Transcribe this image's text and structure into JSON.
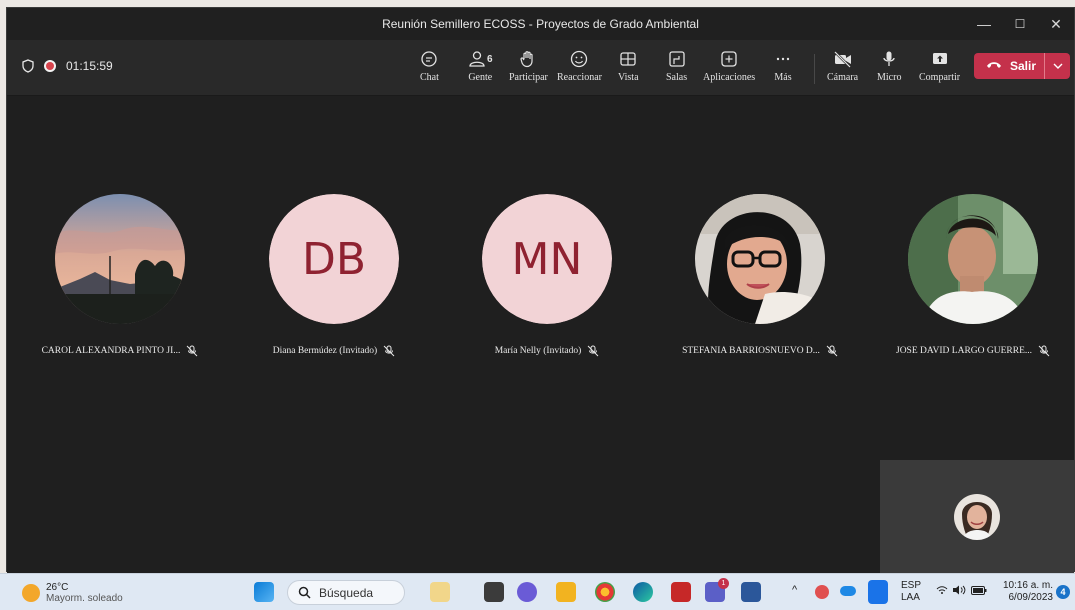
{
  "window": {
    "title": "Reunión Semillero ECOSS - Proyectos de Grado Ambiental",
    "controls": {
      "minimize": "—",
      "maximize": "☐",
      "close": "✕"
    }
  },
  "toolbar": {
    "timer": "01:15:59",
    "chat": "Chat",
    "people": "Gente",
    "people_count": "6",
    "raise": "Participar",
    "react": "Reaccionar",
    "view": "Vista",
    "rooms": "Salas",
    "apps": "Aplicaciones",
    "more": "Más",
    "camera": "Cámara",
    "mic": "Micro",
    "share": "Compartir",
    "leave": "Salir",
    "leave_color": "#c4314b"
  },
  "participants": [
    {
      "name": "CAROL ALEXANDRA PINTO JI...",
      "avatar": "sunset-photo"
    },
    {
      "name": "Diana Bermúdez (Invitado)",
      "initials": "DB"
    },
    {
      "name": "María Nelly (Invitado)",
      "initials": "MN"
    },
    {
      "name": "STEFANIA BARRIOSNUEVO D...",
      "avatar": "woman-glasses-photo"
    },
    {
      "name": "JOSE DAVID LARGO GUERRE...",
      "avatar": "man-photo"
    }
  ],
  "taskbar": {
    "weather_temp": "26°C",
    "weather_desc": "Mayorm. soleado",
    "search": "Búsqueda",
    "lang1": "ESP",
    "lang2": "LAA",
    "time": "10:16 a. m.",
    "date": "6/09/2023",
    "notifications": "4",
    "teams_badge": "1"
  }
}
